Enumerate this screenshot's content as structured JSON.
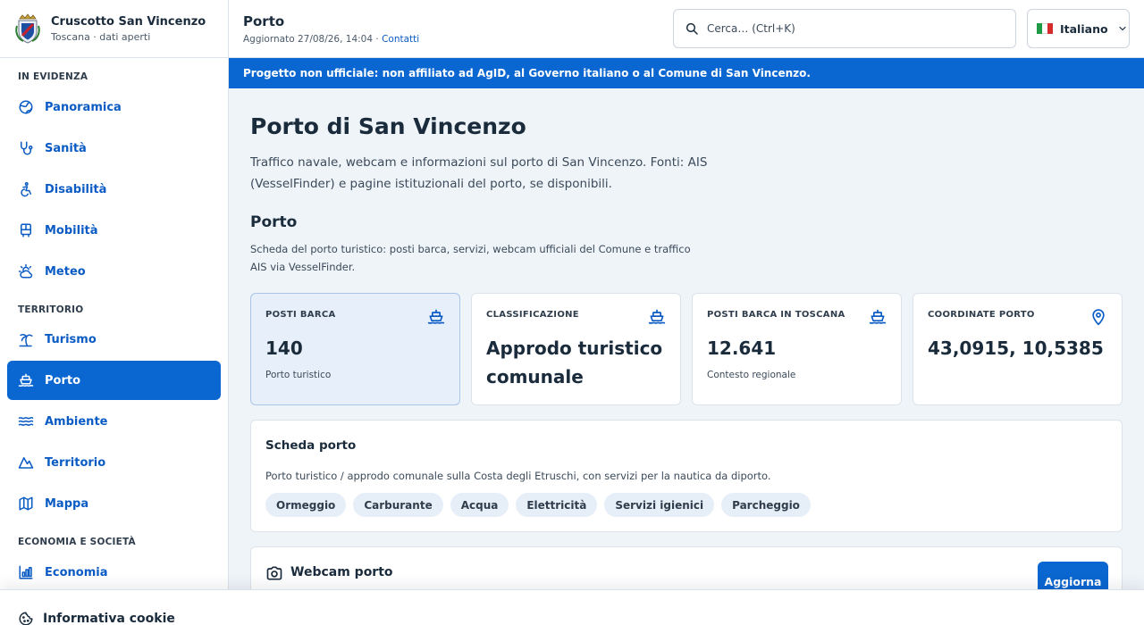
{
  "brand": {
    "title": "Cruscotto San Vincenzo",
    "subtitle": "Toscana · dati aperti"
  },
  "sidebar": {
    "sections": [
      {
        "title": "IN EVIDENZA"
      },
      {
        "title": "TERRITORIO"
      },
      {
        "title": "ECONOMIA E SOCIETÀ"
      }
    ],
    "items": [
      {
        "label": "Panoramica",
        "icon": "globe-icon"
      },
      {
        "label": "Sanità",
        "icon": "stethoscope-icon"
      },
      {
        "label": "Disabilità",
        "icon": "accessibility-icon"
      },
      {
        "label": "Mobilità",
        "icon": "bus-icon"
      },
      {
        "label": "Meteo",
        "icon": "sun-cloud-icon"
      },
      {
        "label": "Turismo",
        "icon": "palm-tree-icon"
      },
      {
        "label": "Porto",
        "icon": "ship-icon",
        "active": true
      },
      {
        "label": "Ambiente",
        "icon": "waves-icon"
      },
      {
        "label": "Territorio",
        "icon": "mountain-icon"
      },
      {
        "label": "Mappa",
        "icon": "map-icon"
      },
      {
        "label": "Economia",
        "icon": "chart-icon"
      }
    ]
  },
  "header": {
    "title": "Porto",
    "updated": "Aggiornato 27/08/26, 14:04 · ",
    "contacts_link": "Contatti",
    "search_placeholder": "Cerca… (Ctrl+K)",
    "language": "Italiano"
  },
  "banner": {
    "text": "Progetto non ufficiale: non affiliato ad AgID, al Governo italiano o al Comune di San Vincenzo."
  },
  "main": {
    "title": "Porto di San Vincenzo",
    "description": "Traffico navale, webcam e informazioni sul porto di San Vincenzo. Fonti: AIS (VesselFinder) e pagine istituzionali del porto, se disponibili.",
    "section_title": "Porto",
    "section_description": "Scheda del porto turistico: posti barca, servizi, webcam ufficiali del Comune e traffico AIS via VesselFinder.",
    "cards": [
      {
        "label": "POSTI BARCA",
        "value": "140",
        "note": "Porto turistico",
        "icon": "ship-icon"
      },
      {
        "label": "CLASSIFICAZIONE",
        "value": "Approdo turistico comunale",
        "note": "",
        "icon": "ship-icon"
      },
      {
        "label": "POSTI BARCA IN TOSCANA",
        "value": "12.641",
        "note": "Contesto regionale",
        "icon": "ship-icon"
      },
      {
        "label": "COORDINATE PORTO",
        "value": "43,0915, 10,5385",
        "note": "",
        "icon": "map-pin-icon"
      }
    ],
    "scheda": {
      "title": "Scheda porto",
      "description": "Porto turistico / approdo comunale sulla Costa degli Etruschi, con servizi per la nautica da diporto.",
      "chips": [
        "Ormeggio",
        "Carburante",
        "Acqua",
        "Elettricità",
        "Servizi igienici",
        "Parcheggio"
      ]
    },
    "webcam": {
      "title": "Webcam porto",
      "refresh_label": "Aggiorna"
    }
  },
  "cookie": {
    "title": "Informativa cookie"
  },
  "colors": {
    "accent": "#0a66d0",
    "link": "#0a5bc4",
    "background": "#eff4f8"
  }
}
